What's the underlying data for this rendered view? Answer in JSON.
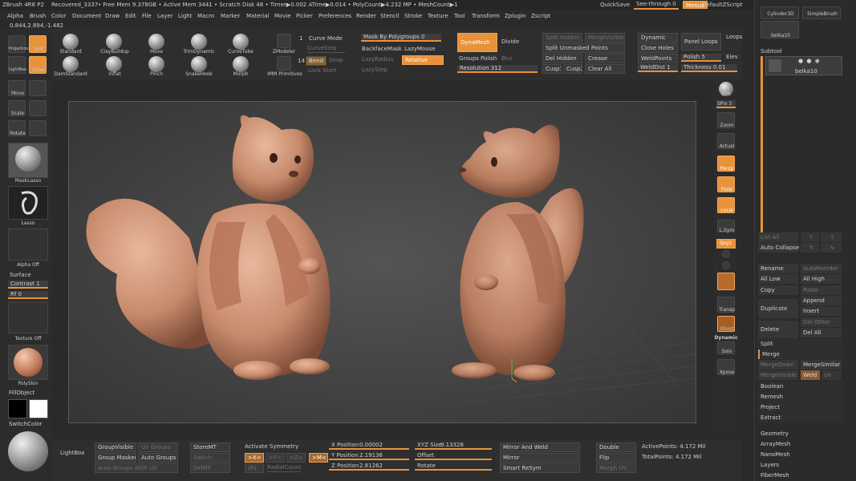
{
  "titlebar": {
    "app": "ZBrush 4R8 P2",
    "doc": "Recovered_3337",
    "stats": "• Free Mem 9.378GB • Active Mem 3441 • Scratch Disk 48 • Timer▶0.002 ATime▶0.014 • PolyCount▶4.232 MP • MeshCount▶1",
    "quicksave": "QuickSave",
    "seethrough": "See-through  0",
    "menus": "Menus",
    "script": "DefaultZScript"
  },
  "menus": [
    "Alpha",
    "Brush",
    "Color",
    "Document",
    "Draw",
    "Edit",
    "File",
    "Layer",
    "Light",
    "Macro",
    "Marker",
    "Material",
    "Movie",
    "Picker",
    "Preferences",
    "Render",
    "Stencil",
    "Stroke",
    "Texture",
    "Tool",
    "Transform",
    "Zplugin",
    "Zscript"
  ],
  "coords": "0.844,2.894,-1.482",
  "left_top": {
    "projection": "Projection Master",
    "edit": "Edit",
    "lightbox": "LightBox",
    "draw": "Draw",
    "move": "Move",
    "scale": "Scale",
    "rotate": "Rotate"
  },
  "brushes": [
    {
      "label": "Standard"
    },
    {
      "label": "ClayBuildup"
    },
    {
      "label": "Move"
    },
    {
      "label": "TrimDynamic"
    },
    {
      "label": "CurveTube"
    },
    {
      "label": "ZModeler"
    },
    {
      "label": "DamStandard"
    },
    {
      "label": "Inflat"
    },
    {
      "label": "Pinch"
    },
    {
      "label": "SnakeHook"
    },
    {
      "label": "Morph"
    },
    {
      "label": "IMM Primitives"
    }
  ],
  "brush_counts": {
    "zmodeler": "1",
    "imm": "14"
  },
  "curve": {
    "mode": "Curve Mode",
    "step": "CurveStep",
    "bend": "Bend",
    "snap": "Snap",
    "lockstart": "Lock Start"
  },
  "mask": {
    "title": "Mask By Polygroups 0",
    "backface": "BackfaceMask",
    "lazymouse": "LazyMouse",
    "lazyradius": "LazyRadius",
    "relative": "Relative",
    "lazystep": "LazyStep"
  },
  "dynamesh": {
    "btn": "DynaMesh",
    "divide": "Divide",
    "groups": "Groups",
    "polish": "Polish",
    "blur": "Blur",
    "resolution": "Resolution 312"
  },
  "split": {
    "hidden": "Split Hidden",
    "mergevisible": "MergeVisible",
    "unmasked": "Split Unmasked Points",
    "delhidden": "Del Hidden",
    "crease": "Crease",
    "cusp1": "Cusp1",
    "cusp2": "Cusp2",
    "clearall": "Clear All"
  },
  "dynamic": {
    "dynamic": "Dynamic",
    "panelloops": "Panel Loops",
    "loops": "Loops",
    "closeholes": "Close Holes",
    "weldpoints": "WeldPoints",
    "polish": "Polish 5",
    "elev": "Elev",
    "welddist": "WeldDist 1",
    "thickness": "Thickness 0.01"
  },
  "left_panel": {
    "masklasso": "MaskLasso",
    "lasso": "Lasso",
    "alphaoff": "Alpha Off",
    "surface": "Surface",
    "contrast": "Contrast 1",
    "rf": "Rf 0",
    "textureoff": "Texture Off",
    "material": "PolySkin",
    "fillobject": "FillObject",
    "switchcolor": "SwitchColor"
  },
  "right_shelf": {
    "bpr": "BPR",
    "spix": "SPix 3",
    "zoom": "Zoom",
    "actual": "Actual",
    "persp": "Persp",
    "floor": "Floor",
    "local": "Local",
    "lsym": "L.Sym",
    "qxyz": "Qxyz",
    "transp": "Transp",
    "ghost": "Ghost",
    "dynamic": "Dynamic",
    "solo": "Solo",
    "xpose": "Xpose"
  },
  "rpanel": {
    "tool1": "Cylinder3D",
    "tool2": "SimpleBrush",
    "current": "belka10",
    "subtool": "Subtool",
    "subtool_item": "belka10",
    "listall": "List All",
    "autocollapse": "Auto Collapse",
    "rename": "Rename",
    "autoreorder": "AutoReorder",
    "alllow": "All Low",
    "allhigh": "All High",
    "copy": "Copy",
    "paste": "Paste",
    "duplicate": "Duplicate",
    "append": "Append",
    "insert": "Insert",
    "delete": "Delete",
    "delother": "Del Other",
    "delall": "Del All",
    "split": "Split",
    "merge": "Merge",
    "mergedown": "MergeDown",
    "mergesimilar": "MergeSimilar",
    "mergevisible": "MergeVisible",
    "weld": "Weld",
    "uv": "Uv",
    "boolean": "Boolean",
    "remesh": "Remesh",
    "project": "Project",
    "extract": "Extract",
    "geometry": "Geometry",
    "arraymesh": "ArrayMesh",
    "nanomesh": "NanoMesh",
    "layers": "Layers",
    "fibermesh": "FiberMesh"
  },
  "bottom": {
    "lightbox": "LightBox",
    "groupvisible": "GroupVisible",
    "uvgroups": "Uv Groups",
    "groupmasked": "Group Masked",
    "autogroups": "Auto Groups",
    "autogroupsuv": "Auto Groups With UV",
    "storemt": "StoreMT",
    "switch": "Switch",
    "delmt": "DelMT",
    "activatesym": "Activate Symmetry",
    "x": ">X<",
    "y": ">Y<",
    "z": ">Z<",
    "m": ">M<",
    "r": "(R)",
    "radialcount": "RadialCount",
    "xpos": "X Position",
    "xposv": "0.00002",
    "ypos": "Y Position",
    "yposv": "2.19136",
    "zpos": "Z Position",
    "zposv": "2.81262",
    "xyzsize": "XYZ Size",
    "xyzsizev": "9.13328",
    "offset": "Offset",
    "rotate": "Rotate",
    "mirrorweld": "Mirror And Weld",
    "mirror": "Mirror",
    "smartresym": "Smart ReSym",
    "double": "Double",
    "flip": "Flip",
    "morphuv": "Morph UV",
    "activepoints": "ActivePoints: 4.172 Mil",
    "totalpoints": "TotalPoints: 4.172 Mil"
  }
}
